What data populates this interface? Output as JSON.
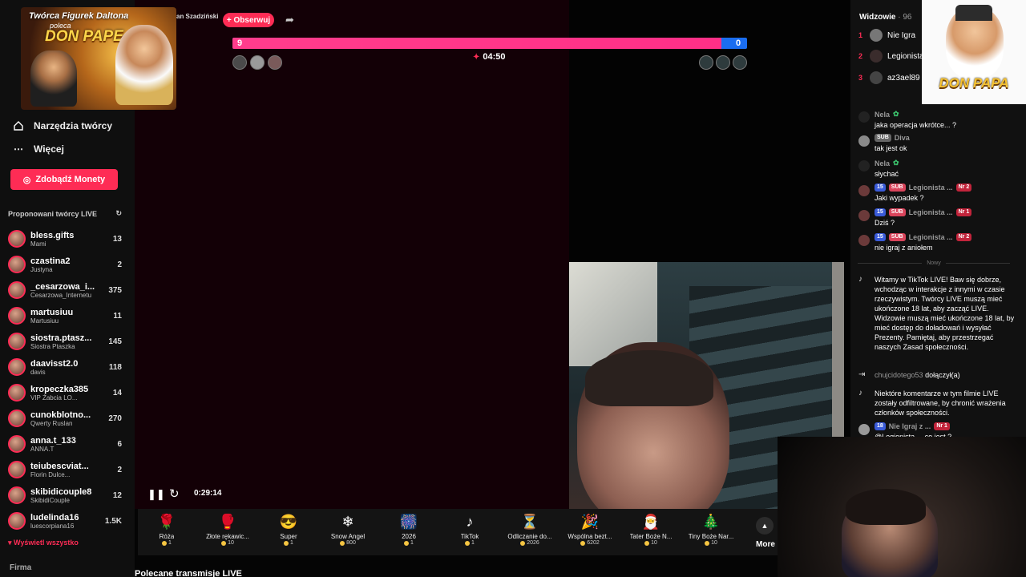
{
  "sidebar": {
    "nav": [
      {
        "label": "Narzędzia twórcy",
        "icon": "home-icon"
      },
      {
        "label": "Więcej",
        "icon": "more-icon"
      }
    ],
    "coins_button": "Zdobądź Monety",
    "suggested_header": "Proponowani twórcy LIVE",
    "creators": [
      {
        "name": "bless.gifts",
        "sub": "Mami",
        "count": "13"
      },
      {
        "name": "czastina2",
        "sub": "Justyna",
        "count": "2"
      },
      {
        "name": "_cesarzowa_i...",
        "sub": "Cesarzowa_Internetu",
        "count": "375"
      },
      {
        "name": "martusiuu",
        "sub": "Martusiuu",
        "count": "11"
      },
      {
        "name": "siostra.ptasz...",
        "sub": "Siostra Ptaszka",
        "count": "145"
      },
      {
        "name": "daavisst2.0",
        "sub": "davis",
        "count": "118"
      },
      {
        "name": "kropeczka385",
        "sub": "VIP Żabcia LO...",
        "count": "14"
      },
      {
        "name": "cunokblotno...",
        "sub": "Qwerty Ruslan",
        "count": "270"
      },
      {
        "name": "anna.t_133",
        "sub": "ANNA.T",
        "count": "6"
      },
      {
        "name": "teiubescviat...",
        "sub": "Florin Dulce...",
        "count": "2"
      },
      {
        "name": "skibidicouple8",
        "sub": "SkibidiCouple",
        "count": "12"
      },
      {
        "name": "ludelinda16",
        "sub": "luescorpiana16",
        "count": "1.5K"
      }
    ],
    "show_all": "Wyświetl wszystko",
    "company": "Firma"
  },
  "promo": {
    "line1": "Twórca Figurek Daltona",
    "line2": "poleca",
    "logo": "DON PAPE"
  },
  "stage": {
    "host_name": "an Szadziński",
    "follow": "+ Obserwuj",
    "score_left": "9",
    "score_right": "0",
    "battle_share": 0.95,
    "timer": "04:50",
    "elapsed": "0:29:14"
  },
  "gifts": [
    {
      "label": "Róża",
      "price": "1",
      "icon": "🌹"
    },
    {
      "label": "Złote rękawic...",
      "price": "10",
      "icon": "🥊"
    },
    {
      "label": "Super",
      "price": "1",
      "icon": "😎"
    },
    {
      "label": "Snow Angel",
      "price": "800",
      "icon": "❄"
    },
    {
      "label": "2026",
      "price": "1",
      "icon": "🎆"
    },
    {
      "label": "TikTok",
      "price": "1",
      "icon": "♪"
    },
    {
      "label": "Odliczanie do...",
      "price": "2026",
      "icon": "⏳"
    },
    {
      "label": "Wspólna bezt...",
      "price": "6202",
      "icon": "🎉"
    },
    {
      "label": "Tater Boże N...",
      "price": "10",
      "icon": "🎅"
    },
    {
      "label": "Tiny Boże Nar...",
      "price": "10",
      "icon": "🎄"
    }
  ],
  "more_label": "More",
  "recommended": "Polecane transmisje LIVE",
  "viewers": {
    "title": "Widzowie",
    "count": "· 96",
    "top": [
      {
        "rank": "1",
        "name": "Nie Igra"
      },
      {
        "rank": "2",
        "name": "Legionista"
      },
      {
        "rank": "3",
        "name": "az3ael89"
      }
    ]
  },
  "brand_logo": "DON PAPA",
  "chat": [
    {
      "user": "Nela",
      "text": "jaka operacja wkrótce... ?"
    },
    {
      "user": "Diva",
      "badges": [
        "SUB"
      ],
      "text": "tak jest ok"
    },
    {
      "user": "Nela",
      "text": "słychać"
    },
    {
      "user": "Legionista ...",
      "level": "15",
      "badges": [
        "SUB"
      ],
      "nr": "Nr 2",
      "text": "Jaki wypadek ?"
    },
    {
      "user": "Legionista ...",
      "level": "15",
      "badges": [
        "SUB"
      ],
      "nr": "Nr 1",
      "text": "Dziś ?"
    },
    {
      "user": "Legionista ...",
      "level": "15",
      "badges": [
        "SUB"
      ],
      "nr": "Nr 2",
      "text": "nie igraj z aniołem"
    }
  ],
  "nowy": "Nowy",
  "system": [
    {
      "text": "Witamy w TikTok LIVE! Baw się dobrze, wchodząc w interakcje z innymi w czasie rzeczywistym. Twórcy LIVE muszą mieć ukończone 18 lat, aby zacząć LIVE. Widzowie muszą mieć ukończone 18 lat, by mieć dostęp do doładowań i wysyłać Prezenty. Pamiętaj, aby przestrzegać naszych Zasad społeczności."
    },
    {
      "user": "chujcidotego53",
      "action": "dołączył(a)"
    },
    {
      "text": "Niektóre komentarze w tym filmie LIVE zostały odfiltrowane, by chronić wrażenia członków społeczności."
    }
  ],
  "last_msg": {
    "user": "Nie Igraj z ...",
    "level": "18",
    "nr": "Nr 1",
    "text": "@Legionista ... co jest ?"
  }
}
